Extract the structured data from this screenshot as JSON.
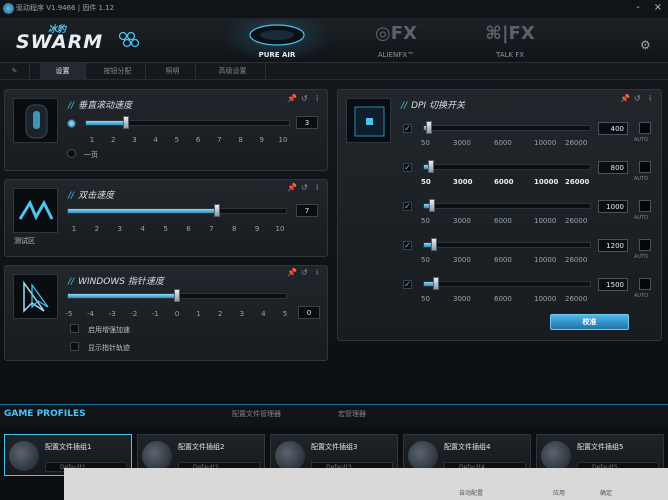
{
  "window": {
    "title": "驱动程序 V1.9466 | 固件 1.12",
    "controls": [
      "-",
      "×"
    ]
  },
  "brand": {
    "small": "冰豹",
    "big": "SWARM"
  },
  "nav": [
    {
      "label": "PURE AIR",
      "active": true
    },
    {
      "label": "ALIENFX™",
      "active": false
    },
    {
      "label": "TALK FX",
      "active": false
    }
  ],
  "tabs": [
    "设置",
    "按钮分配",
    "照明",
    "高级设置"
  ],
  "scroll_panel": {
    "title": "垂直滚动速度",
    "ticks": [
      "1",
      "2",
      "3",
      "4",
      "5",
      "6",
      "7",
      "8",
      "9",
      "10"
    ],
    "value": "3",
    "level_fraction": 0.2,
    "option_page": "一页"
  },
  "dblclick_panel": {
    "title": "双击速度",
    "test_area_label": "测试区",
    "ticks": [
      "1",
      "2",
      "3",
      "4",
      "5",
      "6",
      "7",
      "8",
      "9",
      "10"
    ],
    "value": "7",
    "level_fraction": 0.68
  },
  "pointer_panel": {
    "title": "WINDOWS 指针速度",
    "ticks": [
      "-5",
      "-4",
      "-3",
      "-2",
      "-1",
      "0",
      "1",
      "2",
      "3",
      "4",
      "5"
    ],
    "value": "0",
    "level_fraction": 0.5,
    "options": [
      "启用增强加速",
      "显示指针轨迹"
    ]
  },
  "dpi_panel": {
    "title": "DPI 切换开关",
    "ticks": [
      "50",
      "3000",
      "6000",
      "10000",
      "26000"
    ],
    "auto_label": "AUTO",
    "levels": [
      {
        "value": "400",
        "fraction": 0.015
      },
      {
        "value": "800",
        "fraction": 0.03
      },
      {
        "value": "1000",
        "fraction": 0.038
      },
      {
        "value": "1200",
        "fraction": 0.046
      },
      {
        "value": "1500",
        "fraction": 0.058
      }
    ],
    "calibrate_label": "校准"
  },
  "profiles": {
    "title": "GAME PROFILES",
    "tabs": [
      "配置文件管理器",
      "宏管理器"
    ],
    "slots": [
      {
        "name": "配置文件插组1",
        "default": "Default1"
      },
      {
        "name": "配置文件插组2",
        "default": "Default2"
      },
      {
        "name": "配置文件插组3",
        "default": "Default3"
      },
      {
        "name": "配置文件插组4",
        "default": "Default4"
      },
      {
        "name": "配置文件插组5",
        "default": "Default5"
      }
    ]
  },
  "footer": {
    "buttons": [
      "自动配置",
      "应用",
      "确定"
    ]
  },
  "colors": {
    "accent": "#4ec3f0",
    "background": "#0d1013",
    "panel": "#1c2125"
  }
}
